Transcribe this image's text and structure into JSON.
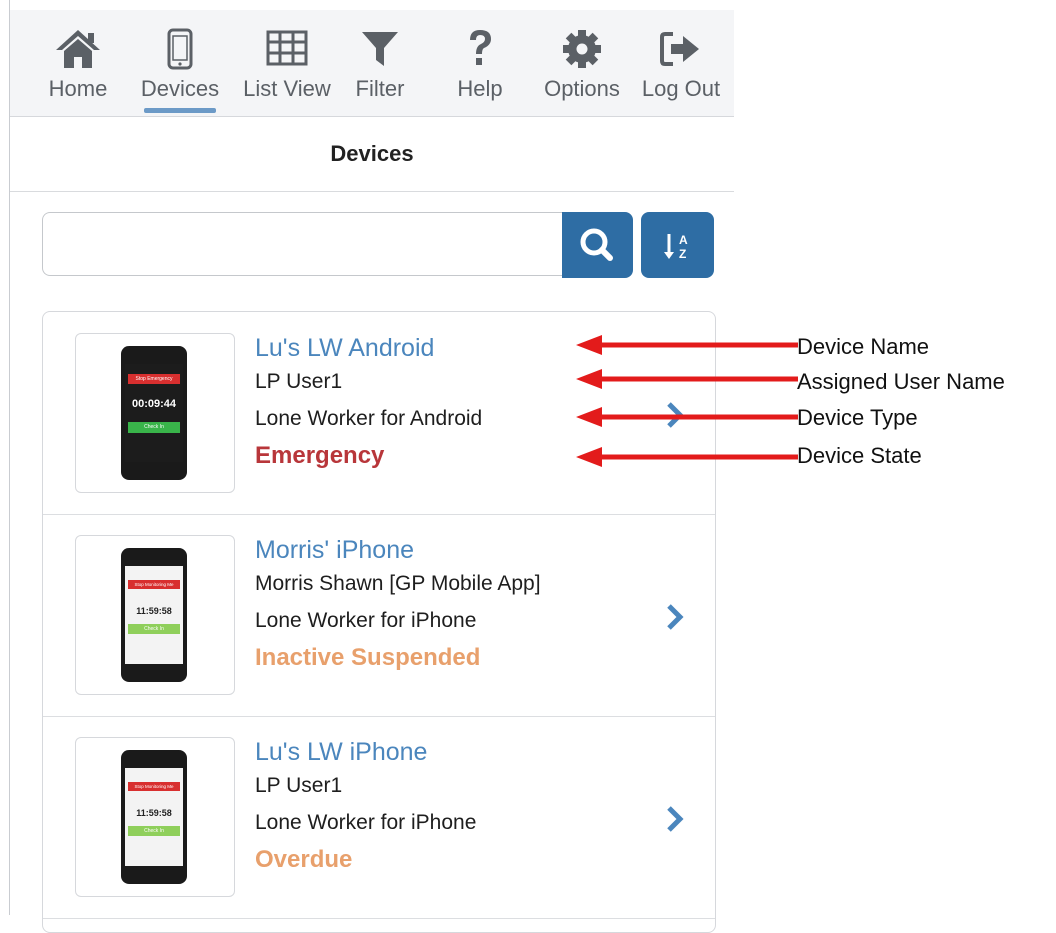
{
  "nav": {
    "items": [
      {
        "label": "Home",
        "icon": "home-icon"
      },
      {
        "label": "Devices",
        "icon": "mobile-icon",
        "active": true
      },
      {
        "label": "List View",
        "icon": "table-icon"
      },
      {
        "label": "Filter",
        "icon": "filter-icon"
      },
      {
        "label": "Help",
        "icon": "question-icon"
      },
      {
        "label": "Options",
        "icon": "gear-icon"
      },
      {
        "label": "Log Out",
        "icon": "logout-icon"
      }
    ]
  },
  "page": {
    "title": "Devices"
  },
  "search": {
    "value": "",
    "placeholder": ""
  },
  "sort": {
    "glyph_top": "A",
    "glyph_bottom": "Z"
  },
  "devices": [
    {
      "name": "Lu's LW Android",
      "user": "LP User1",
      "type": "Lone Worker for Android",
      "state": "Emergency",
      "state_color": "#b8363a",
      "screen": {
        "banner": "Stop Emergency",
        "timer": "00:09:44",
        "button": "Check In"
      }
    },
    {
      "name": "Morris' iPhone",
      "user": "Morris Shawn [GP Mobile App]",
      "type": "Lone Worker for iPhone",
      "state": "Inactive Suspended",
      "state_color": "#e8a06c",
      "screen": {
        "banner": "Stop Monitoring Me",
        "timer": "11:59:58",
        "button": "Check In"
      }
    },
    {
      "name": "Lu's LW iPhone",
      "user": "LP User1",
      "type": "Lone Worker for iPhone",
      "state": "Overdue",
      "state_color": "#e8a06c",
      "screen": {
        "banner": "Stop Monitoring Me",
        "timer": "11:59:58",
        "button": "Check In"
      }
    }
  ],
  "annotations": [
    {
      "label": "Device Name"
    },
    {
      "label": "Assigned User Name"
    },
    {
      "label": "Device Type"
    },
    {
      "label": "Device State"
    }
  ],
  "colors": {
    "accent": "#2e6da4",
    "link": "#4b86bd",
    "nav_underline": "#6c9ac7",
    "arrow": "#e31b1b"
  }
}
